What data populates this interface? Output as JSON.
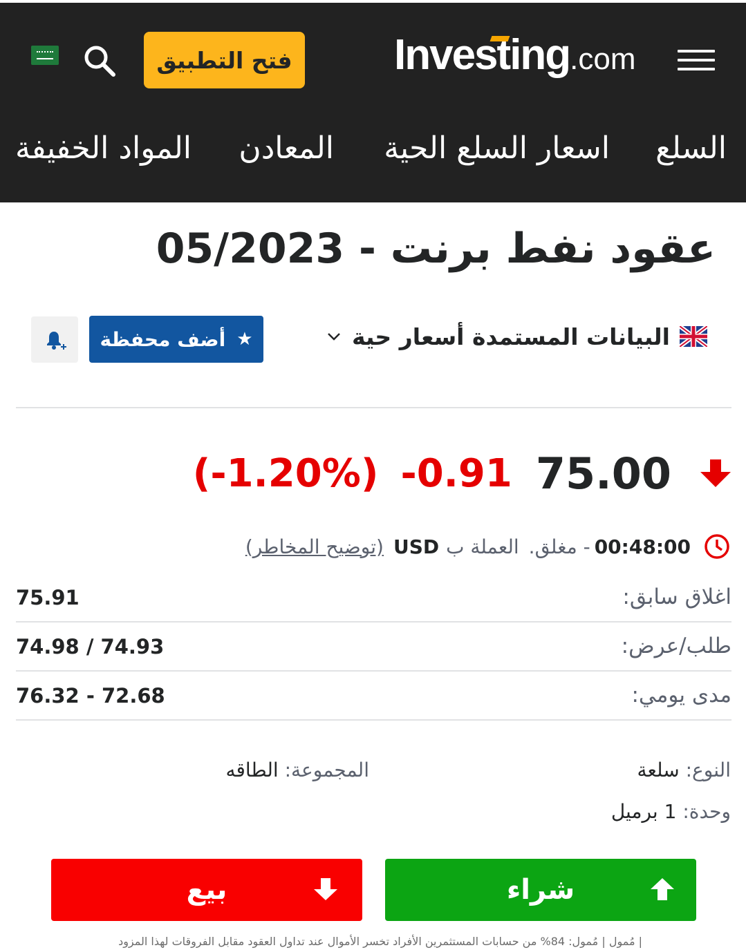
{
  "header": {
    "logo_brand": "Investing",
    "logo_tld": ".com",
    "open_app_label": "فتح التطبيق"
  },
  "nav": {
    "items": [
      "السلع",
      "اسعار السلع الحية",
      "المعادن",
      "المواد الخفيفة"
    ]
  },
  "instrument": {
    "title": "عقود نفط برنت - 05/2023",
    "data_source_label": "البيانات المستمدة أسعار حية",
    "watchlist_label": "أضف محفظة"
  },
  "quote": {
    "last": "75.00",
    "change": "-0.91",
    "change_pct": "(-1.20%)",
    "time": "00:48:00",
    "status_text": "- مغلق.",
    "currency_label": "العملة ب",
    "currency": "USD",
    "risk_label": "(توضيح المخاطر)"
  },
  "stats": [
    {
      "label": "اغلاق سابق:",
      "value": "75.91"
    },
    {
      "label": "طلب/عرض:",
      "value": "74.98 / 74.93"
    },
    {
      "label": "مدى يومي:",
      "value": "76.32 - 72.68"
    }
  ],
  "meta": {
    "type_label": "النوع:",
    "type_value": "سلعة",
    "group_label": "المجموعة:",
    "group_value": "الطاقه",
    "unit_label": "وحدة:",
    "unit_value": "1 برميل"
  },
  "trade": {
    "buy_label": "شراء",
    "sell_label": "بيع",
    "disclaimer": "| مُمول | مُمول: 84% من حسابات المستثمرين الأفراد تخسر الأموال عند تداول العقود مقابل الفروقات لهذا المزود"
  },
  "colors": {
    "header_bg": "#222222",
    "accent_orange": "#fdb51c",
    "watchlist_blue": "#1256a0",
    "negative_red": "#e50000",
    "buy_green": "#0ca513",
    "sell_red": "#f90000"
  },
  "icons": {
    "menu": "hamburger-icon",
    "search": "search-icon",
    "country_flag": "saudi-flag-icon",
    "data_flag": "uk-flag-icon",
    "dropdown": "chevron-down-icon",
    "star": "star-icon",
    "alert": "bell-plus-icon",
    "trend": "arrow-down-icon",
    "clock": "clock-icon",
    "buy": "arrow-up-icon",
    "sell": "arrow-down-icon"
  }
}
